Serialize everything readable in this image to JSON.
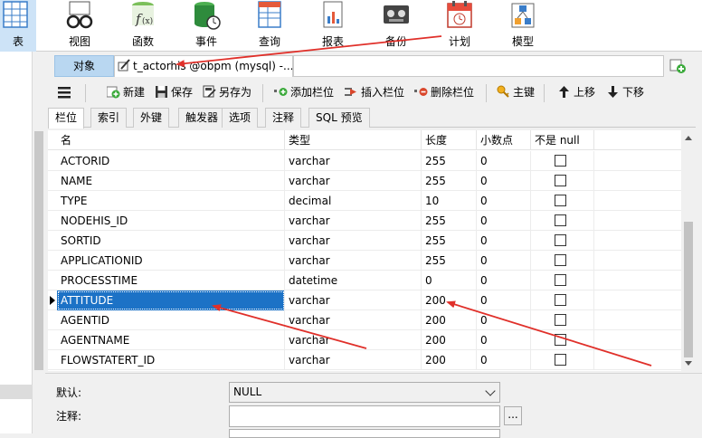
{
  "ribbon": [
    {
      "name": "ribbon-table",
      "label": "表",
      "icon": "table-icon",
      "active": true
    },
    {
      "name": "ribbon-view",
      "label": "视图",
      "icon": "glasses-icon"
    },
    {
      "name": "ribbon-function",
      "label": "函数",
      "icon": "function-icon"
    },
    {
      "name": "ribbon-event",
      "label": "事件",
      "icon": "event-icon"
    },
    {
      "name": "ribbon-query",
      "label": "查询",
      "icon": "query-icon"
    },
    {
      "name": "ribbon-report",
      "label": "报表",
      "icon": "report-icon"
    },
    {
      "name": "ribbon-backup",
      "label": "备份",
      "icon": "backup-icon"
    },
    {
      "name": "ribbon-schedule",
      "label": "计划",
      "icon": "calendar-icon"
    },
    {
      "name": "ribbon-model",
      "label": "模型",
      "icon": "model-icon"
    }
  ],
  "tabs": {
    "objects": "对象",
    "doc_title": "t_actorhis @obpm (mysql) -..."
  },
  "toolbar": {
    "new": "新建",
    "save": "保存",
    "save_as": "另存为",
    "add_field": "添加栏位",
    "insert_field": "插入栏位",
    "delete_field": "删除栏位",
    "primary_key": "主键",
    "move_up": "上移",
    "move_down": "下移"
  },
  "subtabs": [
    "栏位",
    "索引",
    "外键",
    "触发器",
    "选项",
    "注释",
    "SQL 预览"
  ],
  "grid": {
    "headers": [
      "名",
      "类型",
      "长度",
      "小数点",
      "不是 null"
    ],
    "rows": [
      {
        "name": "ACTORID",
        "type": "varchar",
        "length": "255",
        "decimals": "0",
        "not_null": false
      },
      {
        "name": "NAME",
        "type": "varchar",
        "length": "255",
        "decimals": "0",
        "not_null": false
      },
      {
        "name": "TYPE",
        "type": "decimal",
        "length": "10",
        "decimals": "0",
        "not_null": false
      },
      {
        "name": "NODEHIS_ID",
        "type": "varchar",
        "length": "255",
        "decimals": "0",
        "not_null": false
      },
      {
        "name": "SORTID",
        "type": "varchar",
        "length": "255",
        "decimals": "0",
        "not_null": false
      },
      {
        "name": "APPLICATIONID",
        "type": "varchar",
        "length": "255",
        "decimals": "0",
        "not_null": false
      },
      {
        "name": "PROCESSTIME",
        "type": "datetime",
        "length": "0",
        "decimals": "0",
        "not_null": false
      },
      {
        "name": "ATTITUDE",
        "type": "varchar",
        "length": "200",
        "decimals": "0",
        "not_null": false,
        "selected": true
      },
      {
        "name": "AGENTID",
        "type": "varchar",
        "length": "200",
        "decimals": "0",
        "not_null": false
      },
      {
        "name": "AGENTNAME",
        "type": "varchar",
        "length": "200",
        "decimals": "0",
        "not_null": false
      },
      {
        "name": "FLOWSTATERT_ID",
        "type": "varchar",
        "length": "200",
        "decimals": "0",
        "not_null": false
      }
    ]
  },
  "props": {
    "default_label": "默认:",
    "default_value": "NULL",
    "comment_label": "注释:",
    "comment_value": "",
    "more_button": "..."
  },
  "colors": {
    "selection": "#1c72c6",
    "annotation_arrow": "#e0302a",
    "active_tab": "#b9d7f1"
  }
}
